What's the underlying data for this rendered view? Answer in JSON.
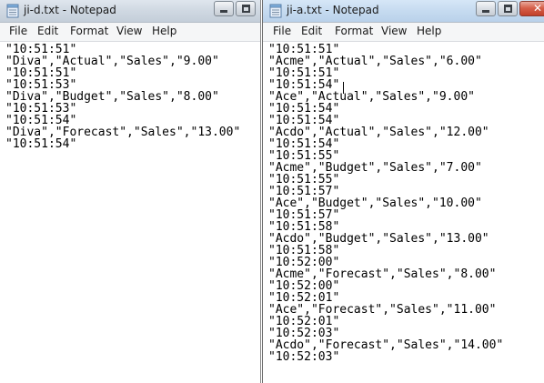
{
  "windows": {
    "left": {
      "title": "ji-d.txt - Notepad",
      "menu": [
        "File",
        "Edit",
        "Format",
        "View",
        "Help"
      ],
      "lines": [
        "\"10:51:51\"",
        "\"Diva\",\"Actual\",\"Sales\",\"9.00\"",
        "\"10:51:51\"",
        "\"10:51:53\"",
        "\"Diva\",\"Budget\",\"Sales\",\"8.00\"",
        "\"10:51:53\"",
        "\"10:51:54\"",
        "\"Diva\",\"Forecast\",\"Sales\",\"13.00\"",
        "\"10:51:54\""
      ]
    },
    "right": {
      "title": "ji-a.txt - Notepad",
      "menu": [
        "File",
        "Edit",
        "Format",
        "View",
        "Help"
      ],
      "lines": [
        "\"10:51:51\"",
        "\"Acme\",\"Actual\",\"Sales\",\"6.00\"",
        "\"10:51:51\"",
        "\"10:51:54\"",
        "\"Ace\",\"Actual\",\"Sales\",\"9.00\"",
        "\"10:51:54\"",
        "\"10:51:54\"",
        "\"Acdo\",\"Actual\",\"Sales\",\"12.00\"",
        "\"10:51:54\"",
        "\"10:51:55\"",
        "\"Acme\",\"Budget\",\"Sales\",\"7.00\"",
        "\"10:51:55\"",
        "\"10:51:57\"",
        "\"Ace\",\"Budget\",\"Sales\",\"10.00\"",
        "\"10:51:57\"",
        "\"10:51:58\"",
        "\"Acdo\",\"Budget\",\"Sales\",\"13.00\"",
        "\"10:51:58\"",
        "\"10:52:00\"",
        "\"Acme\",\"Forecast\",\"Sales\",\"8.00\"",
        "\"10:52:00\"",
        "\"10:52:01\"",
        "\"Ace\",\"Forecast\",\"Sales\",\"11.00\"",
        "\"10:52:01\"",
        "\"10:52:03\"",
        "\"Acdo\",\"Forecast\",\"Sales\",\"14.00\"",
        "\"10:52:03\""
      ]
    }
  },
  "icons": {
    "app": "notepad-icon",
    "minimize": "minimize-icon",
    "maximize": "maximize-icon",
    "close": "close-icon"
  },
  "colors": {
    "close_button": "#c2402a",
    "titlebar_inactive": "#cfd8e2",
    "titlebar_active": "#c6dbf0"
  }
}
